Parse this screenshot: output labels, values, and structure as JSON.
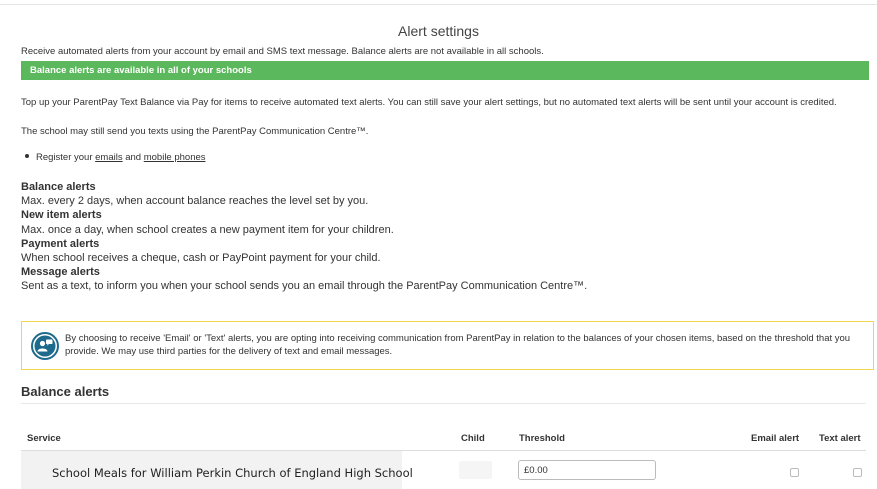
{
  "page": {
    "title": "Alert settings",
    "intro": "Receive automated alerts from your account by email and SMS text message. Balance alerts are not available in all schools.",
    "green_banner": "Balance alerts are available in all of your schools",
    "topup_text": "Top up your ParentPay Text Balance via Pay for items to receive automated text alerts. You can still save your alert settings, but no automated text alerts will be sent until your account is credited.",
    "school_text": "The school may still send you texts using the ParentPay Communication Centre™.",
    "register": {
      "prefix": "Register your ",
      "emails_link": "emails",
      "middle": " and ",
      "phones_link": "mobile phones"
    }
  },
  "alert_types": [
    {
      "heading": "Balance alerts",
      "desc": "Max. every 2 days, when account balance reaches the level set by you."
    },
    {
      "heading": "New item alerts",
      "desc": "Max. once a day, when school creates a new payment item for your children."
    },
    {
      "heading": "Payment alerts",
      "desc": "When school receives a cheque, cash or PayPoint payment for your child."
    },
    {
      "heading": "Message alerts",
      "desc": "Sent as a text, to inform you when your school sends you an email through the ParentPay Communication Centre™."
    }
  ],
  "notice": {
    "icon": "person-chat-icon",
    "text": "By choosing to receive 'Email' or 'Text' alerts, you are opting into receiving communication from ParentPay in relation to the balances of your chosen items, based on the threshold that you provide. We may use third parties for the delivery of text and email messages."
  },
  "balance_section": {
    "heading": "Balance alerts",
    "columns": {
      "service": "Service",
      "child": "Child",
      "threshold": "Threshold",
      "email": "Email alert",
      "text": "Text alert"
    },
    "rows": [
      {
        "service": "School Meals for William Perkin Church of England High School",
        "child": "",
        "threshold": "£0.00",
        "email": false,
        "text": false
      }
    ]
  },
  "colors": {
    "accent_green": "#5cb85c",
    "notice_border": "#f2d64a",
    "icon_blue": "#1d6a8c"
  }
}
